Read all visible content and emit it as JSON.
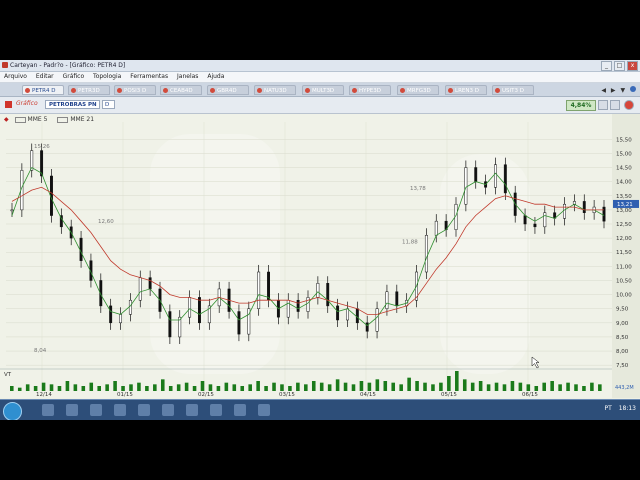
{
  "window": {
    "title": "Carteyan - Padr?o - [Gráfico: PETR4 D]",
    "controls": [
      "_",
      "□",
      "x"
    ]
  },
  "menu": [
    "Arquivo",
    "Editar",
    "Gráfico",
    "Topologia",
    "Ferramentas",
    "Janelas",
    "Ajuda"
  ],
  "tabs": [
    "PETR4 D",
    "PETR3D",
    "POSI3 D",
    "CEAB4D",
    "GBR4D",
    "NATU3D",
    "MULT3D",
    "HYPE3D",
    "MRFG3D",
    "LREN3 D",
    "USIT3 D"
  ],
  "toolbar": {
    "label": "Gráfico",
    "symbol": "PETROBRAS PN",
    "period": "D",
    "change": "4,84%"
  },
  "legend": {
    "ma1": "MME 5",
    "ma2": "MME 21"
  },
  "volume_label": "VT",
  "volume_value": "443,2M",
  "current_price": "13,21",
  "colors": {
    "ma_fast": "#2f8f2f",
    "ma_slow": "#c0392b",
    "candle": "#111111",
    "volume": "#1a7a1a"
  },
  "chart_data": {
    "type": "line",
    "title": "",
    "xlabel": "",
    "ylabel": "",
    "ylim": [
      7.4,
      15.9
    ],
    "y_ticks": [
      "15,50",
      "15,00",
      "14,50",
      "14,00",
      "13,50",
      "13,00",
      "12,50",
      "12,00",
      "11,50",
      "11,00",
      "10,50",
      "10,00",
      "9,50",
      "9,00",
      "8,50",
      "8,00",
      "7,50"
    ],
    "y_tick_values": [
      15.5,
      15.0,
      14.5,
      14.0,
      13.5,
      13.0,
      12.5,
      12.0,
      11.5,
      11.0,
      10.5,
      10.0,
      9.5,
      9.0,
      8.5,
      8.0,
      7.5
    ],
    "x_ticks": [
      "12/14",
      "01/15",
      "02/15",
      "03/15",
      "04/15",
      "05/15",
      "06/15"
    ],
    "annotations": [
      {
        "text": "15,26",
        "value": 15.26
      },
      {
        "text": "12,60",
        "value": 12.6
      },
      {
        "text": "8,04",
        "value": 8.04
      },
      {
        "text": "13,78",
        "value": 13.78
      },
      {
        "text": "11,88",
        "value": 11.88
      }
    ],
    "series": [
      {
        "name": "PETROBRAS PN",
        "values": [
          13.0,
          14.4,
          15.1,
          14.2,
          12.8,
          12.4,
          12.0,
          11.2,
          10.5,
          9.6,
          9.0,
          9.3,
          9.8,
          10.6,
          10.2,
          9.4,
          8.5,
          9.2,
          9.9,
          9.0,
          9.6,
          10.2,
          9.4,
          8.6,
          9.5,
          10.8,
          9.8,
          9.2,
          9.8,
          9.4,
          9.9,
          10.4,
          9.6,
          9.1,
          9.5,
          9.0,
          8.7,
          9.5,
          10.1,
          9.6,
          9.8,
          10.8,
          12.1,
          12.6,
          12.3,
          13.2,
          14.5,
          14.0,
          13.8,
          14.6,
          13.6,
          12.8,
          12.5,
          12.4,
          12.9,
          12.7,
          13.2,
          13.3,
          12.9,
          13.1,
          12.6
        ]
      },
      {
        "name": "MME 5",
        "values": [
          12.8,
          13.8,
          14.5,
          14.3,
          13.4,
          12.7,
          12.2,
          11.5,
          10.8,
          10.0,
          9.4,
          9.3,
          9.6,
          10.1,
          10.2,
          9.8,
          9.1,
          9.1,
          9.5,
          9.3,
          9.5,
          9.9,
          9.6,
          9.1,
          9.3,
          10.0,
          9.9,
          9.5,
          9.7,
          9.5,
          9.7,
          10.1,
          9.8,
          9.4,
          9.5,
          9.2,
          8.9,
          9.2,
          9.7,
          9.6,
          9.7,
          10.3,
          11.3,
          12.1,
          12.3,
          12.8,
          13.8,
          14.0,
          13.9,
          14.3,
          13.9,
          13.2,
          12.8,
          12.6,
          12.8,
          12.7,
          13.0,
          13.2,
          13.0,
          13.0,
          12.8
        ]
      },
      {
        "name": "MME 21",
        "values": [
          13.3,
          13.5,
          13.7,
          13.8,
          13.6,
          13.3,
          13.0,
          12.6,
          12.2,
          11.7,
          11.2,
          10.9,
          10.7,
          10.6,
          10.5,
          10.3,
          10.0,
          9.9,
          9.9,
          9.8,
          9.8,
          9.9,
          9.8,
          9.7,
          9.7,
          9.8,
          9.8,
          9.8,
          9.8,
          9.7,
          9.8,
          9.9,
          9.8,
          9.7,
          9.6,
          9.5,
          9.3,
          9.3,
          9.4,
          9.5,
          9.6,
          9.9,
          10.4,
          10.9,
          11.3,
          11.8,
          12.4,
          12.8,
          13.1,
          13.4,
          13.5,
          13.4,
          13.3,
          13.2,
          13.2,
          13.1,
          13.1,
          13.1,
          13.0,
          13.0,
          13.0
        ]
      }
    ],
    "volume": [
      3,
      2,
      4,
      3,
      5,
      4,
      3,
      6,
      4,
      3,
      5,
      3,
      4,
      6,
      3,
      4,
      5,
      3,
      4,
      7,
      3,
      4,
      5,
      3,
      6,
      4,
      3,
      5,
      4,
      3,
      4,
      6,
      3,
      5,
      4,
      3,
      5,
      4,
      6,
      5,
      4,
      7,
      5,
      4,
      6,
      5,
      7,
      6,
      5,
      4,
      8,
      6,
      5,
      4,
      5,
      9,
      12,
      7,
      5,
      6,
      4,
      5,
      4,
      6,
      5,
      4,
      3,
      5,
      6,
      4,
      5,
      4,
      3,
      5,
      4
    ]
  },
  "taskbar": {
    "tray": [
      "PT",
      "18:13"
    ]
  }
}
